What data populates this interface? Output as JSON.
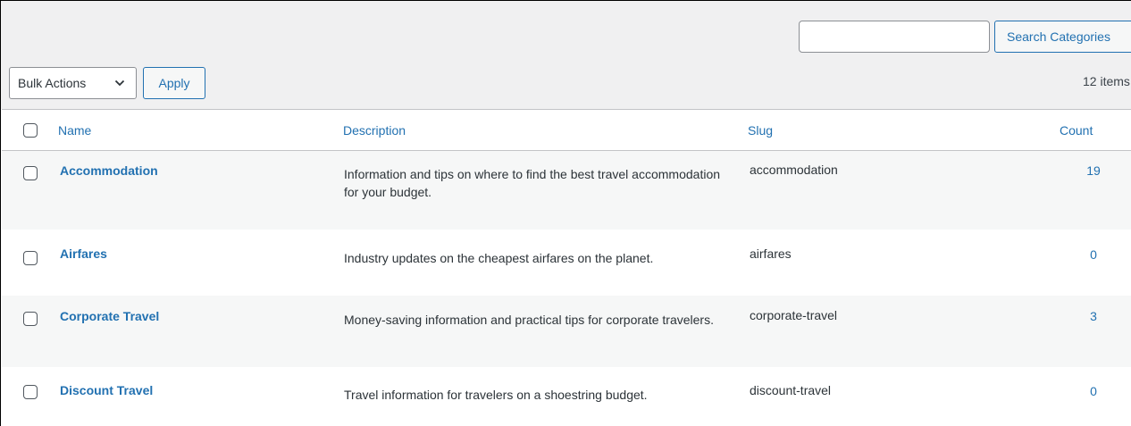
{
  "search": {
    "input_value": "",
    "button_label": "Search Categories"
  },
  "bulk": {
    "select_label": "Bulk Actions",
    "apply_label": "Apply"
  },
  "items_count": "12 items",
  "table": {
    "columns": {
      "name": "Name",
      "description": "Description",
      "slug": "Slug",
      "count": "Count"
    },
    "rows": [
      {
        "name": "Accommodation",
        "description": "Information and tips on where to find the best travel accommodation for your budget.",
        "slug": "accommodation",
        "count": "19"
      },
      {
        "name": "Airfares",
        "description": "Industry updates on the cheapest airfares on the planet.",
        "slug": "airfares",
        "count": "0"
      },
      {
        "name": "Corporate Travel",
        "description": "Money-saving information and practical tips for corporate travelers.",
        "slug": "corporate-travel",
        "count": "3"
      },
      {
        "name": "Discount Travel",
        "description": "Travel information for travelers on a shoestring budget.",
        "slug": "discount-travel",
        "count": "0"
      }
    ]
  },
  "colors": {
    "link": "#2271b1",
    "alt_row": "#f6f7f7",
    "admin_bg": "#f0f0f1"
  }
}
